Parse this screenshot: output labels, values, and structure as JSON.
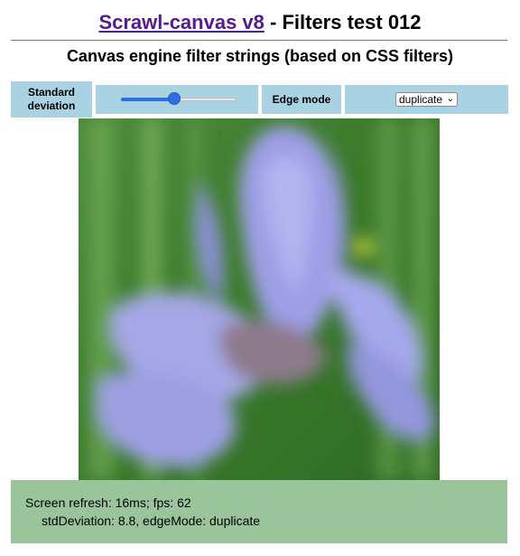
{
  "header": {
    "title_link": "Scrawl-canvas v8",
    "title_suffix": " - Filters test 012",
    "subtitle": "Canvas engine filter strings (based on CSS filters)"
  },
  "controls": {
    "std_dev_label": "Standard deviation",
    "std_dev_slider_fraction": 0.46,
    "edge_mode_label": "Edge mode",
    "edge_mode_selected": "duplicate"
  },
  "canvas": {
    "content": "blurred photo of a pale purple iris flower against green foliage"
  },
  "report": {
    "line1": "Screen refresh: 16ms; fps: 62",
    "line2": "stdDeviation: 8.8, edgeMode: duplicate"
  },
  "colors": {
    "control_bg": "#a9d2e3",
    "report_bg": "#9ac59b",
    "link": "#551a8b",
    "slider_accent": "#2f6fe0"
  }
}
